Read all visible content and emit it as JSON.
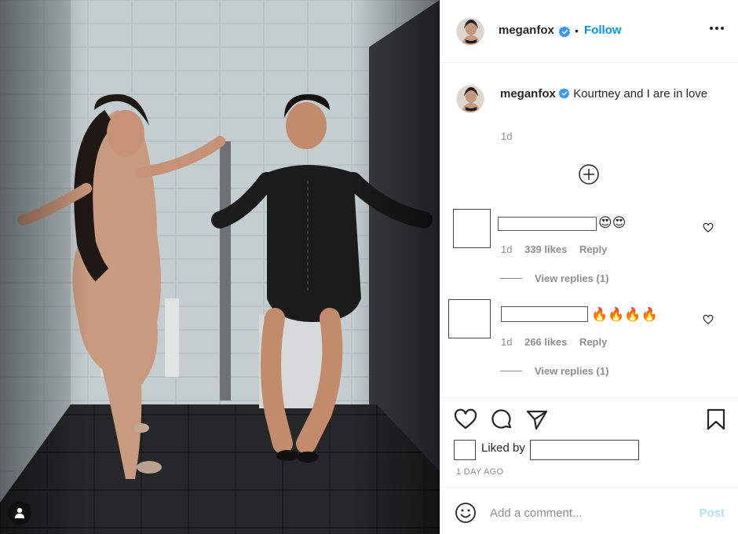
{
  "post": {
    "author": "meganfox",
    "follow_label": "Follow",
    "separator": "•",
    "verified_icon": "verified-badge-icon",
    "accent": "#0095f6"
  },
  "caption": {
    "author": "meganfox",
    "text": "Kourtney and I are in love",
    "time": "1d"
  },
  "comments": [
    {
      "emojis": "😍😍",
      "time": "1d",
      "likes": "339 likes",
      "reply_label": "Reply",
      "view_replies": "View replies (1)"
    },
    {
      "emojis": "🔥🔥🔥🔥",
      "time": "1d",
      "likes": "266 likes",
      "reply_label": "Reply",
      "view_replies": "View replies (1)"
    }
  ],
  "footer": {
    "liked_by_label": "Liked by",
    "date": "1 DAY AGO",
    "comment_placeholder": "Add a comment...",
    "post_label": "Post"
  },
  "icons": [
    "heart-icon",
    "comment-icon",
    "share-icon",
    "bookmark-icon",
    "emoji-icon",
    "user-tag-icon",
    "more-options-icon",
    "load-more-comments-icon"
  ]
}
